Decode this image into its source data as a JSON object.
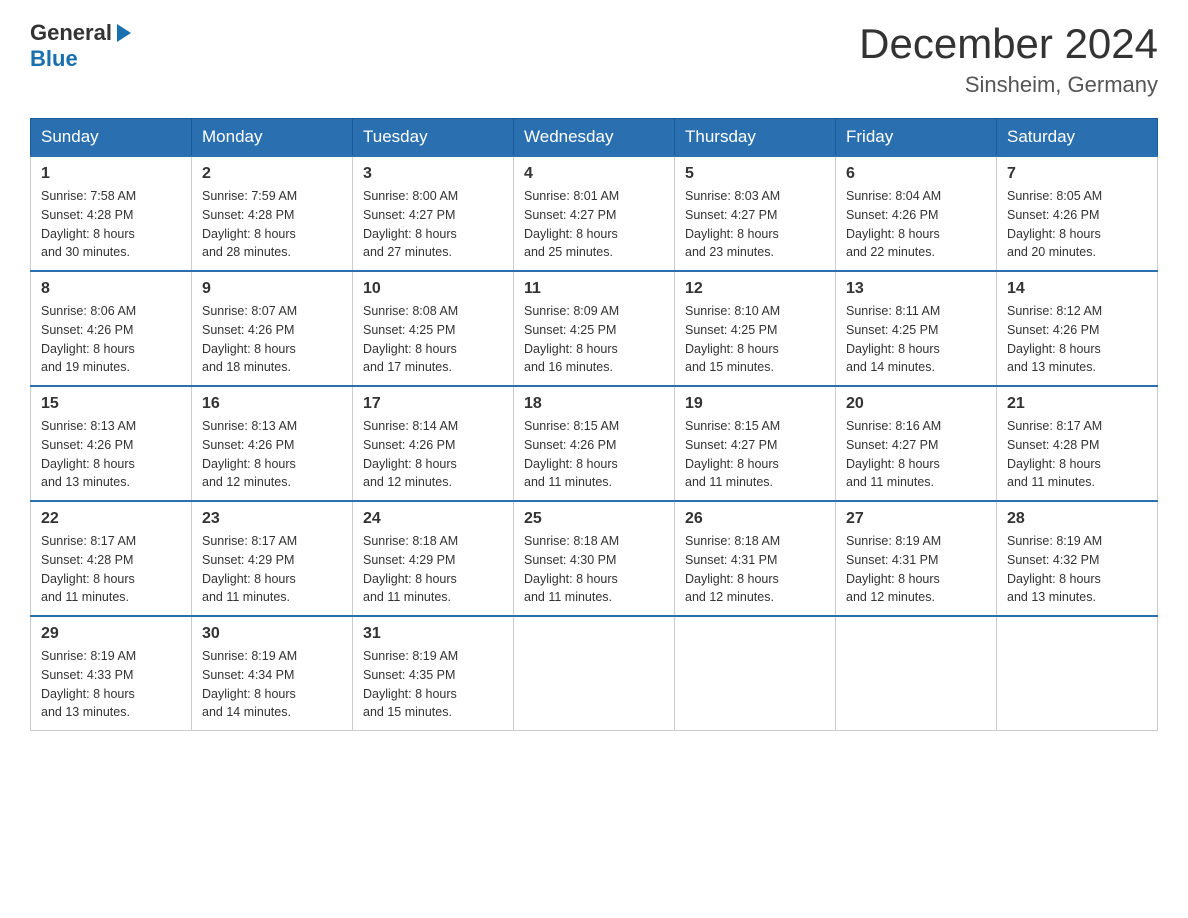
{
  "header": {
    "logo": {
      "general": "General",
      "blue": "Blue"
    },
    "title": "December 2024",
    "location": "Sinsheim, Germany"
  },
  "weekdays": [
    "Sunday",
    "Monday",
    "Tuesday",
    "Wednesday",
    "Thursday",
    "Friday",
    "Saturday"
  ],
  "weeks": [
    [
      {
        "day": "1",
        "sunrise": "7:58 AM",
        "sunset": "4:28 PM",
        "daylight": "8 hours and 30 minutes."
      },
      {
        "day": "2",
        "sunrise": "7:59 AM",
        "sunset": "4:28 PM",
        "daylight": "8 hours and 28 minutes."
      },
      {
        "day": "3",
        "sunrise": "8:00 AM",
        "sunset": "4:27 PM",
        "daylight": "8 hours and 27 minutes."
      },
      {
        "day": "4",
        "sunrise": "8:01 AM",
        "sunset": "4:27 PM",
        "daylight": "8 hours and 25 minutes."
      },
      {
        "day": "5",
        "sunrise": "8:03 AM",
        "sunset": "4:27 PM",
        "daylight": "8 hours and 23 minutes."
      },
      {
        "day": "6",
        "sunrise": "8:04 AM",
        "sunset": "4:26 PM",
        "daylight": "8 hours and 22 minutes."
      },
      {
        "day": "7",
        "sunrise": "8:05 AM",
        "sunset": "4:26 PM",
        "daylight": "8 hours and 20 minutes."
      }
    ],
    [
      {
        "day": "8",
        "sunrise": "8:06 AM",
        "sunset": "4:26 PM",
        "daylight": "8 hours and 19 minutes."
      },
      {
        "day": "9",
        "sunrise": "8:07 AM",
        "sunset": "4:26 PM",
        "daylight": "8 hours and 18 minutes."
      },
      {
        "day": "10",
        "sunrise": "8:08 AM",
        "sunset": "4:25 PM",
        "daylight": "8 hours and 17 minutes."
      },
      {
        "day": "11",
        "sunrise": "8:09 AM",
        "sunset": "4:25 PM",
        "daylight": "8 hours and 16 minutes."
      },
      {
        "day": "12",
        "sunrise": "8:10 AM",
        "sunset": "4:25 PM",
        "daylight": "8 hours and 15 minutes."
      },
      {
        "day": "13",
        "sunrise": "8:11 AM",
        "sunset": "4:25 PM",
        "daylight": "8 hours and 14 minutes."
      },
      {
        "day": "14",
        "sunrise": "8:12 AM",
        "sunset": "4:26 PM",
        "daylight": "8 hours and 13 minutes."
      }
    ],
    [
      {
        "day": "15",
        "sunrise": "8:13 AM",
        "sunset": "4:26 PM",
        "daylight": "8 hours and 13 minutes."
      },
      {
        "day": "16",
        "sunrise": "8:13 AM",
        "sunset": "4:26 PM",
        "daylight": "8 hours and 12 minutes."
      },
      {
        "day": "17",
        "sunrise": "8:14 AM",
        "sunset": "4:26 PM",
        "daylight": "8 hours and 12 minutes."
      },
      {
        "day": "18",
        "sunrise": "8:15 AM",
        "sunset": "4:26 PM",
        "daylight": "8 hours and 11 minutes."
      },
      {
        "day": "19",
        "sunrise": "8:15 AM",
        "sunset": "4:27 PM",
        "daylight": "8 hours and 11 minutes."
      },
      {
        "day": "20",
        "sunrise": "8:16 AM",
        "sunset": "4:27 PM",
        "daylight": "8 hours and 11 minutes."
      },
      {
        "day": "21",
        "sunrise": "8:17 AM",
        "sunset": "4:28 PM",
        "daylight": "8 hours and 11 minutes."
      }
    ],
    [
      {
        "day": "22",
        "sunrise": "8:17 AM",
        "sunset": "4:28 PM",
        "daylight": "8 hours and 11 minutes."
      },
      {
        "day": "23",
        "sunrise": "8:17 AM",
        "sunset": "4:29 PM",
        "daylight": "8 hours and 11 minutes."
      },
      {
        "day": "24",
        "sunrise": "8:18 AM",
        "sunset": "4:29 PM",
        "daylight": "8 hours and 11 minutes."
      },
      {
        "day": "25",
        "sunrise": "8:18 AM",
        "sunset": "4:30 PM",
        "daylight": "8 hours and 11 minutes."
      },
      {
        "day": "26",
        "sunrise": "8:18 AM",
        "sunset": "4:31 PM",
        "daylight": "8 hours and 12 minutes."
      },
      {
        "day": "27",
        "sunrise": "8:19 AM",
        "sunset": "4:31 PM",
        "daylight": "8 hours and 12 minutes."
      },
      {
        "day": "28",
        "sunrise": "8:19 AM",
        "sunset": "4:32 PM",
        "daylight": "8 hours and 13 minutes."
      }
    ],
    [
      {
        "day": "29",
        "sunrise": "8:19 AM",
        "sunset": "4:33 PM",
        "daylight": "8 hours and 13 minutes."
      },
      {
        "day": "30",
        "sunrise": "8:19 AM",
        "sunset": "4:34 PM",
        "daylight": "8 hours and 14 minutes."
      },
      {
        "day": "31",
        "sunrise": "8:19 AM",
        "sunset": "4:35 PM",
        "daylight": "8 hours and 15 minutes."
      },
      null,
      null,
      null,
      null
    ]
  ],
  "labels": {
    "sunrise": "Sunrise:",
    "sunset": "Sunset:",
    "daylight": "Daylight:"
  }
}
